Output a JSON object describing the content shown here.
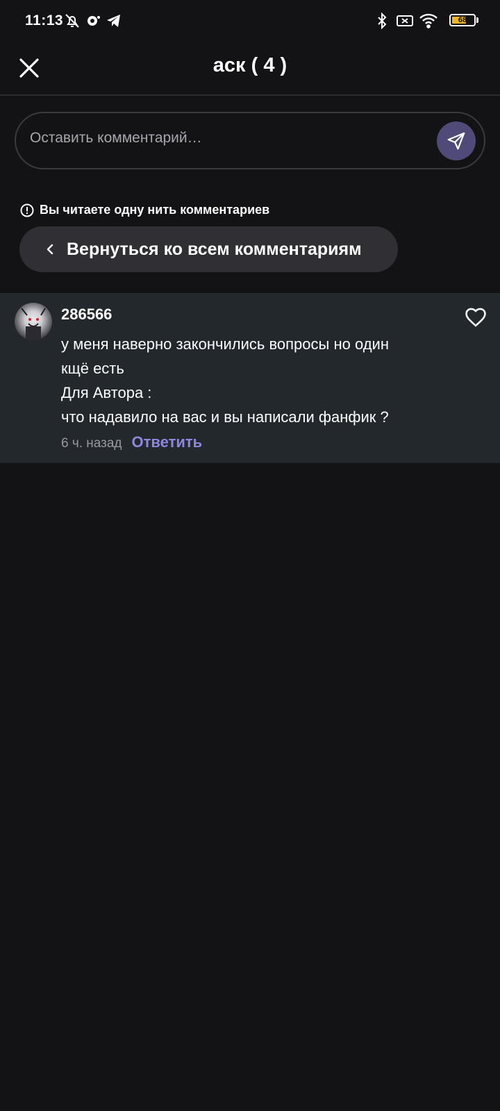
{
  "status_bar": {
    "time": "11:13",
    "battery_level": "68",
    "battery_fraction": 0.68
  },
  "header": {
    "title": "аск ( 4 )"
  },
  "comment_input": {
    "placeholder": "Оставить комментарий…"
  },
  "thread": {
    "notice": "Вы читаете одну нить комментариев",
    "back_label": "Вернуться ко всем комментариям"
  },
  "comment": {
    "username": "286566",
    "lines": [
      "у меня наверно закончились вопросы но один",
      "кщё есть",
      "Для Автора :",
      "что надавило на вас и вы написали фанфик ?"
    ],
    "timestamp": "6 ч. назад",
    "reply_label": "Ответить"
  },
  "colors": {
    "background": "#131215",
    "comment_highlight": "#22282c",
    "accent": "#8f86e0",
    "send_button": "#4f4a78"
  }
}
